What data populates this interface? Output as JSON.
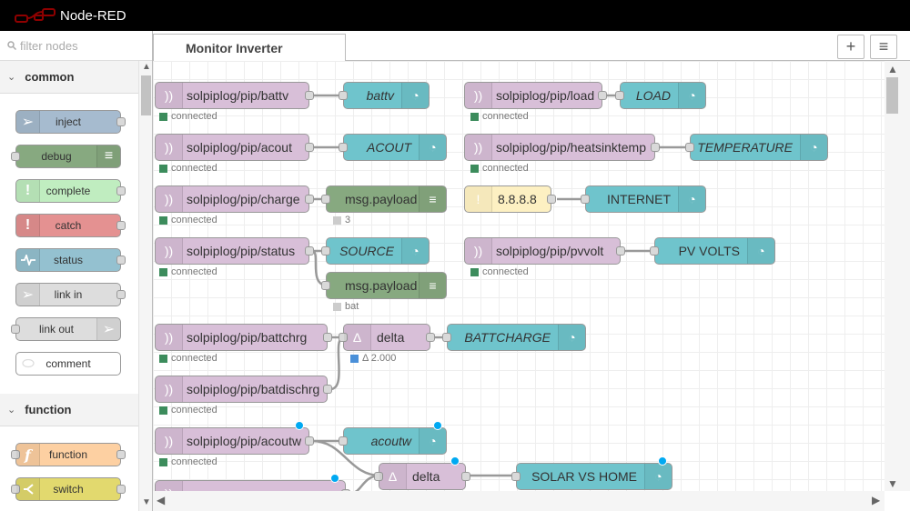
{
  "app": {
    "title": "Node-RED"
  },
  "palette": {
    "filter_placeholder": "filter nodes",
    "categories": [
      {
        "name": "common",
        "nodes": [
          {
            "label": "inject",
            "color": "#a6bbcf",
            "icon": "inject-icon"
          },
          {
            "label": "debug",
            "color": "#87a980",
            "icon": "debug-list-icon"
          },
          {
            "label": "complete",
            "color": "#c0edc0",
            "icon": "exclamation-icon"
          },
          {
            "label": "catch",
            "color": "#e49191",
            "icon": "exclamation-icon"
          },
          {
            "label": "status",
            "color": "#94c1d0",
            "icon": "status-pulse-icon"
          },
          {
            "label": "link in",
            "color": "#dddddd",
            "icon": "link-in-icon"
          },
          {
            "label": "link out",
            "color": "#dddddd",
            "icon": "link-out-icon"
          },
          {
            "label": "comment",
            "color": "#ffffff",
            "icon": "comment-icon"
          }
        ]
      },
      {
        "name": "function",
        "nodes": [
          {
            "label": "function",
            "color": "#fdd0a2",
            "icon": "function-icon"
          },
          {
            "label": "switch",
            "color": "#e2d96e",
            "icon": "switch-icon"
          }
        ]
      }
    ]
  },
  "workspace": {
    "tab_label": "Monitor Inverter",
    "add_button": "+",
    "list_button": "≡"
  },
  "flow": {
    "mqtt_color": "#d8bfd8",
    "gauge_color": "#6fc4cc",
    "debug_color": "#87a980",
    "ping_color": "#fdf0c2",
    "status_connected_color": "#3c8c5c",
    "nodes": {
      "mqtt_battv": "solpiplog/pip/battv",
      "mqtt_acout": "solpiplog/pip/acout",
      "mqtt_charge": "solpiplog/pip/charge",
      "mqtt_status": "solpiplog/pip/status",
      "mqtt_load": "solpiplog/pip/load",
      "mqtt_heatsink": "solpiplog/pip/heatsinktemp",
      "ping": "8.8.8.8",
      "mqtt_pvvolt": "solpiplog/pip/pvvolt",
      "mqtt_battchrg": "solpiplog/pip/battchrg",
      "mqtt_batdischrg": "solpiplog/pip/batdischrg",
      "mqtt_acoutw": "solpiplog/pip/acoutw",
      "gauge_battv": "battv",
      "gauge_acout": "ACOUT",
      "debug_charge": "msg.payload",
      "gauge_source": "SOURCE",
      "debug_bat": "msg.payload",
      "gauge_load": "LOAD",
      "gauge_temperature": "TEMPERATURE",
      "gauge_internet": "INTERNET",
      "gauge_pvvolts": "PV VOLTS",
      "delta1": "delta",
      "gauge_battcharge": "BATTCHARGE",
      "gauge_acoutw": "acoutw",
      "delta2": "delta",
      "gauge_solar": "SOLAR VS HOME"
    },
    "statuses": {
      "connected": "connected",
      "debug_charge": "3",
      "debug_bat": "bat",
      "delta1": "Δ 2.000"
    }
  }
}
